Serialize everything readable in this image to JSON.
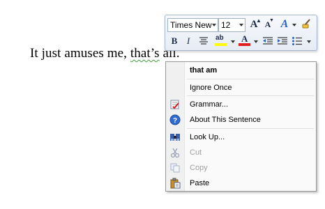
{
  "document": {
    "text_before": "It just amuses me, ",
    "flagged_text": "that’s",
    "text_after": " all."
  },
  "mini_toolbar": {
    "font_name": "Times New",
    "font_size": "12",
    "grow_font_glyph": "A",
    "shrink_font_glyph": "A",
    "styles_glyph": "A",
    "bold_glyph": "B",
    "italic_glyph": "I",
    "font_color_glyph": "A",
    "highlight_glyph": "ab",
    "highlight_color": "#ffff00",
    "font_color": "#e02020"
  },
  "context_menu": {
    "items": [
      {
        "label": "that am",
        "icon": "none"
      },
      {
        "label": "Ignore Once",
        "icon": "none"
      },
      {
        "label": "Grammar...",
        "icon": "grammar-check-icon"
      },
      {
        "label": "About This Sentence",
        "icon": "help-icon"
      },
      {
        "label": "Look Up...",
        "icon": "research-binoculars-icon"
      },
      {
        "label": "Cut",
        "icon": "scissors-icon"
      },
      {
        "label": "Copy",
        "icon": "copy-icon"
      },
      {
        "label": "Paste",
        "icon": "clipboard-paste-icon"
      }
    ]
  }
}
